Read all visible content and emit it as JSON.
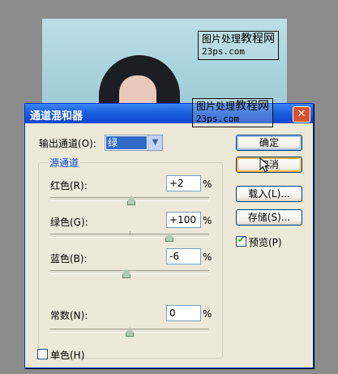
{
  "watermark_top": {
    "line1": "图片处理",
    "line1_big": "教程网",
    "line2": "23ps.com"
  },
  "watermark_bottom": {
    "line1": "图片处理",
    "line1_big": "教程网",
    "line2": "23ps.com"
  },
  "dialog": {
    "title": "通道混和器",
    "close_glyph": "✕",
    "output_channel_label": "输出通道(O):",
    "output_channel_value": "绿",
    "source_group_title": "源通道",
    "red": {
      "label": "红色(R):",
      "value": "+2",
      "unit": "%",
      "level_percent": 51
    },
    "green": {
      "label": "绿色(G):",
      "value": "+100",
      "unit": "%",
      "level_percent": 75
    },
    "blue": {
      "label": "蓝色(B):",
      "value": "-6",
      "unit": "%",
      "level_percent": 48
    },
    "constant": {
      "label": "常数(N):",
      "value": "0",
      "unit": "%",
      "level_percent": 50
    },
    "monochrome": {
      "label": "单色(H)",
      "checked": false
    },
    "buttons": {
      "ok": "确定",
      "cancel": "取消",
      "load": "载入(L)...",
      "save": "存储(S)..."
    },
    "preview": {
      "label": "预览(P)",
      "checked": true
    }
  },
  "colors": {
    "title_bar": "#0c46cf",
    "dialog_bg": "#ece9d8",
    "selection": "#316ac5",
    "group_title": "#0046d5"
  }
}
